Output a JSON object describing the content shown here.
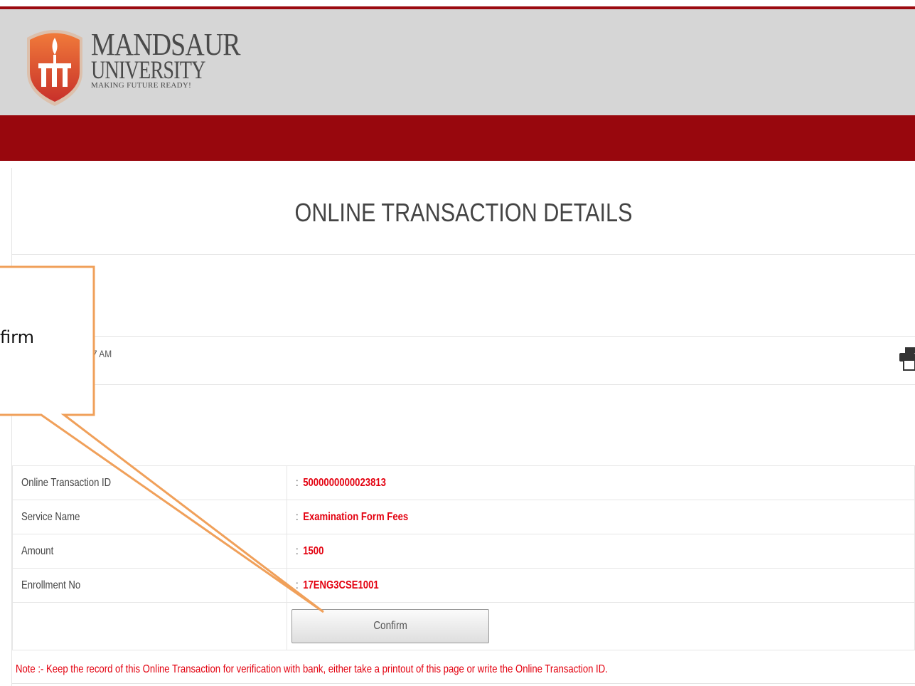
{
  "header": {
    "brand_name": "MANDSAUR",
    "brand_sub": "UNIVERSITY",
    "tagline": "MAKING FUTURE READY!"
  },
  "page": {
    "title": "ONLINE TRANSACTION DETAILS",
    "time_fragment": "7 AM"
  },
  "details": {
    "rows": [
      {
        "label": "Online Transaction ID",
        "value": "5000000000023813"
      },
      {
        "label": "Service Name",
        "value": "Examination Form Fees"
      },
      {
        "label": "Amount",
        "value": "1500"
      },
      {
        "label": "Enrollment No",
        "value": "17ENG3CSE1001"
      }
    ],
    "separator": ":",
    "confirm_label": "Confirm"
  },
  "note": "Note :- Keep the record of this Online Transaction for verification with bank, either take a printout of this page or write the Online Transaction ID.",
  "callout": {
    "text_fragment": "firm"
  },
  "colors": {
    "brand_red": "#98070d",
    "value_red": "#e3000f",
    "callout_orange": "#f0a05a"
  },
  "icons": {
    "logo": "university-shield-logo",
    "print": "printer-icon"
  }
}
